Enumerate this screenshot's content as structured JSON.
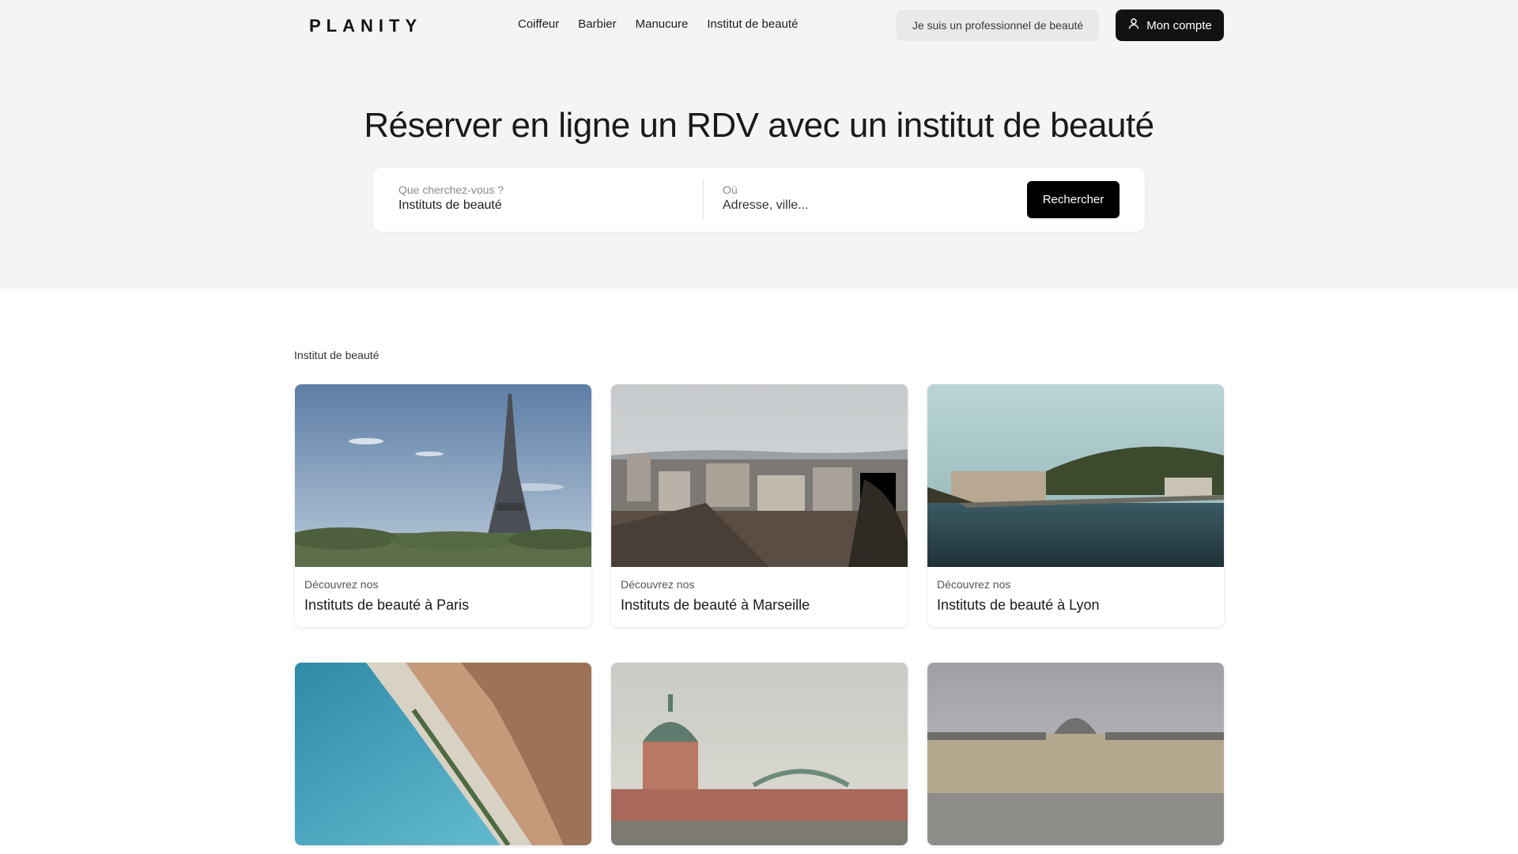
{
  "header": {
    "logo": "PLANITY",
    "nav": [
      "Coiffeur",
      "Barbier",
      "Manucure",
      "Institut de beauté"
    ],
    "pro_button": "Je suis un professionnel de beauté",
    "account_button": "Mon compte"
  },
  "hero": {
    "headline": "Réserver en ligne un RDV avec un institut de beauté",
    "search": {
      "what_label": "Que cherchez-vous ?",
      "what_value": "Instituts de beauté",
      "where_label": "Où",
      "where_placeholder": "Adresse, ville...",
      "button": "Rechercher"
    }
  },
  "section": {
    "title": "Institut de beauté",
    "cards": [
      {
        "kicker": "Découvrez nos",
        "title": "Instituts de beauté à Paris"
      },
      {
        "kicker": "Découvrez nos",
        "title": "Instituts de beauté à Marseille"
      },
      {
        "kicker": "Découvrez nos",
        "title": "Instituts de beauté à Lyon"
      }
    ]
  }
}
